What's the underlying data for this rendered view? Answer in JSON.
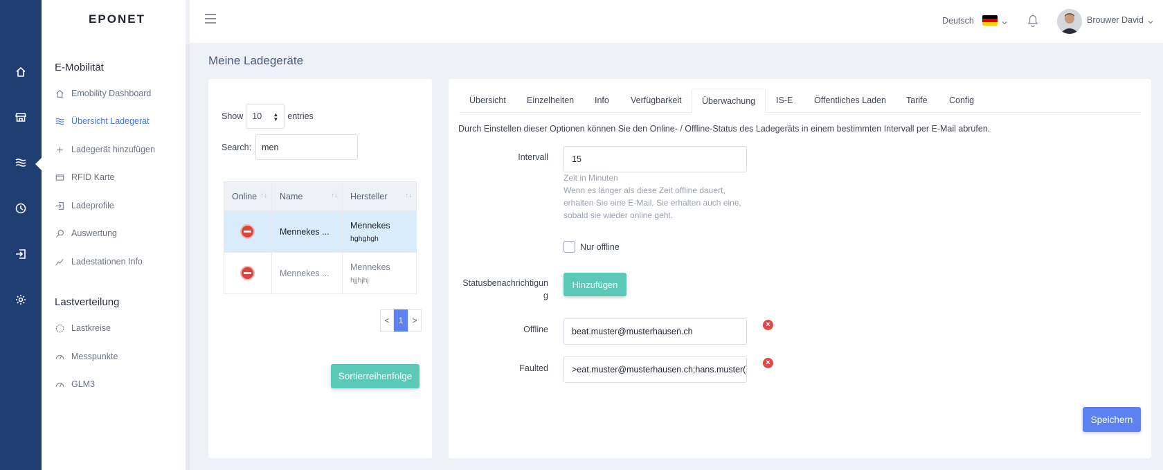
{
  "header": {
    "logo": "EPONET",
    "language": "Deutsch",
    "language_flag": "de-flag-icon",
    "user_name": "Brouwer David"
  },
  "rail": {
    "icons": [
      "home-icon",
      "store-icon",
      "waves-icon",
      "clock-icon",
      "login-icon",
      "gear-icon"
    ],
    "active_index": 2
  },
  "sidebar": {
    "section1": "E-Mobilität",
    "items1": [
      {
        "label": "Emobility Dashboard",
        "icon": "home-icon"
      },
      {
        "label": "Übersicht Ladegerät",
        "icon": "waves-icon",
        "active": true
      },
      {
        "label": "Ladegerät hinzufügen",
        "icon": "plus-icon"
      },
      {
        "label": "RFID Karte",
        "icon": "card-icon"
      },
      {
        "label": "Ladeprofile",
        "icon": "login-icon"
      },
      {
        "label": "Auswertung",
        "icon": "search-icon"
      },
      {
        "label": "Ladestationen Info",
        "icon": "chart-icon"
      }
    ],
    "section2": "Lastverteilung",
    "items2": [
      {
        "label": "Lastkreise",
        "icon": "circle-icon"
      },
      {
        "label": "Messpunkte",
        "icon": "gauge-icon"
      },
      {
        "label": "GLM3",
        "icon": "gauge-icon"
      }
    ]
  },
  "page": {
    "title": "Meine Ladegeräte"
  },
  "list": {
    "show_label": "Show",
    "entries_value": "10",
    "entries_label": "entries",
    "search_label": "Search:",
    "search_value": "men",
    "columns": [
      "Online",
      "Name",
      "Hersteller"
    ],
    "rows": [
      {
        "name": "Mennekes ...",
        "manufacturer": "Mennekes",
        "sub": "hghghgh",
        "selected": true
      },
      {
        "name": "Mennekes ...",
        "manufacturer": "Mennekes",
        "sub": "hjjhjhj",
        "selected": false
      }
    ],
    "pager": {
      "prev": "<",
      "current": "1",
      "next": ">"
    },
    "sort_button": "Sortierreihenfolge"
  },
  "tabs": [
    {
      "label": "Übersicht"
    },
    {
      "label": "Einzelheiten"
    },
    {
      "label": "Info"
    },
    {
      "label": "Verfügbarkeit"
    },
    {
      "label": "Überwachung",
      "active": true
    },
    {
      "label": "IS-E"
    },
    {
      "label": "Öffentliches Laden"
    },
    {
      "label": "Tarife"
    },
    {
      "label": "Config"
    }
  ],
  "monitoring": {
    "description": "Durch Einstellen dieser Optionen können Sie den Online- / Offline-Status des Ladegeräts in einem bestimmten Intervall per E-Mail abrufen.",
    "interval_label": "Intervall",
    "interval_value": "15",
    "help_line1": "Zeit in Minuten",
    "help_line2": "Wenn es länger als diese Zeit offline dauert,",
    "help_line3": "erhalten Sie eine E-Mail. Sie erhalten auch eine,",
    "help_line4": "sobald sie wieder online geht.",
    "checkbox_label": "Nur offline",
    "checkbox_checked": false,
    "status_label_1": "Statusbenachrichtigun",
    "status_label_2": "g",
    "add_button": "Hinzufügen",
    "offline_label": "Offline",
    "offline_value": "beat.muster@musterhausen.ch",
    "faulted_label": "Faulted",
    "faulted_value": ">eat.muster@musterhausen.ch;hans.muster(",
    "save_button": "Speichern"
  }
}
